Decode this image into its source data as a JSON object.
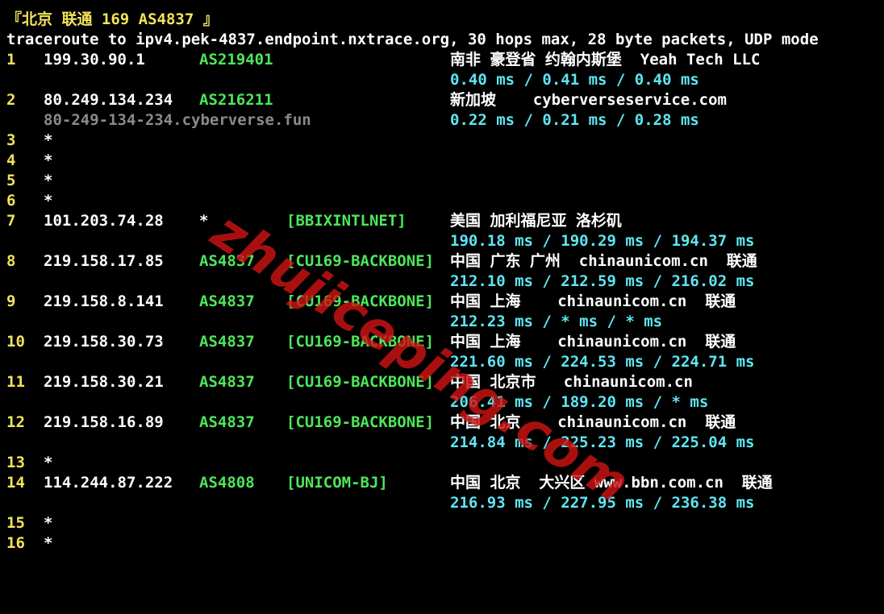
{
  "header": {
    "title": "『北京 联通 169 AS4837 』",
    "command": "traceroute to ipv4.pek-4837.endpoint.nxtrace.org, 30 hops max, 28 byte packets, UDP mode"
  },
  "hops": [
    {
      "num": "1",
      "ip": "199.30.90.1",
      "asn": "AS219401",
      "tag": "",
      "geo": "南非 豪登省 约翰内斯堡  Yeah Tech LLC",
      "times": "0.40 ms / 0.41 ms / 0.40 ms"
    },
    {
      "num": "2",
      "ip": "80.249.134.234",
      "asn": "AS216211",
      "tag": "",
      "geo": "新加坡    cyberverseservice.com",
      "host": "80-249-134-234.cyberverse.fun",
      "times": "0.22 ms / 0.21 ms / 0.28 ms"
    },
    {
      "num": "3",
      "ip": "*"
    },
    {
      "num": "4",
      "ip": "*"
    },
    {
      "num": "5",
      "ip": "*"
    },
    {
      "num": "6",
      "ip": "*"
    },
    {
      "num": "7",
      "ip": "101.203.74.28",
      "asn": "*",
      "tag": "[BBIXINTLNET]",
      "geo": "美国 加利福尼亚 洛杉矶",
      "times": "190.18 ms / 190.29 ms / 194.37 ms"
    },
    {
      "num": "8",
      "ip": "219.158.17.85",
      "asn": "AS4837",
      "tag": "[CU169-BACKBONE]",
      "geo": "中国 广东 广州  chinaunicom.cn  联通",
      "times": "212.10 ms / 212.59 ms / 216.02 ms"
    },
    {
      "num": "9",
      "ip": "219.158.8.141",
      "asn": "AS4837",
      "tag": "[CU169-BACKBONE]",
      "geo": "中国 上海    chinaunicom.cn  联通",
      "times": "212.23 ms / * ms / * ms"
    },
    {
      "num": "10",
      "ip": "219.158.30.73",
      "asn": "AS4837",
      "tag": "[CU169-BACKBONE]",
      "geo": "中国 上海    chinaunicom.cn  联通",
      "times": "221.60 ms / 224.53 ms / 224.71 ms"
    },
    {
      "num": "11",
      "ip": "219.158.30.21",
      "asn": "AS4837",
      "tag": "[CU169-BACKBONE]",
      "geo": "中国 北京市   chinaunicom.cn",
      "times": "206.41 ms / 189.20 ms / * ms"
    },
    {
      "num": "12",
      "ip": "219.158.16.89",
      "asn": "AS4837",
      "tag": "[CU169-BACKBONE]",
      "geo": "中国 北京    chinaunicom.cn  联通",
      "times": "214.84 ms / 225.23 ms / 225.04 ms"
    },
    {
      "num": "13",
      "ip": "*"
    },
    {
      "num": "14",
      "ip": "114.244.87.222",
      "asn": "AS4808",
      "tag": "[UNICOM-BJ]",
      "geo": "中国 北京  大兴区 www.bbn.com.cn  联通",
      "times": "216.93 ms / 227.95 ms / 236.38 ms"
    },
    {
      "num": "15",
      "ip": "*"
    },
    {
      "num": "16",
      "ip": "*"
    }
  ],
  "watermark": "zhujiceping.com",
  "colors": {
    "background": "#000000",
    "hop_number": "#f2e35a",
    "ip": "#ffffff",
    "asn": "#4de65a",
    "latency": "#5ee6f2",
    "hostname": "#8a8a8a",
    "watermark": "#cd1414"
  }
}
